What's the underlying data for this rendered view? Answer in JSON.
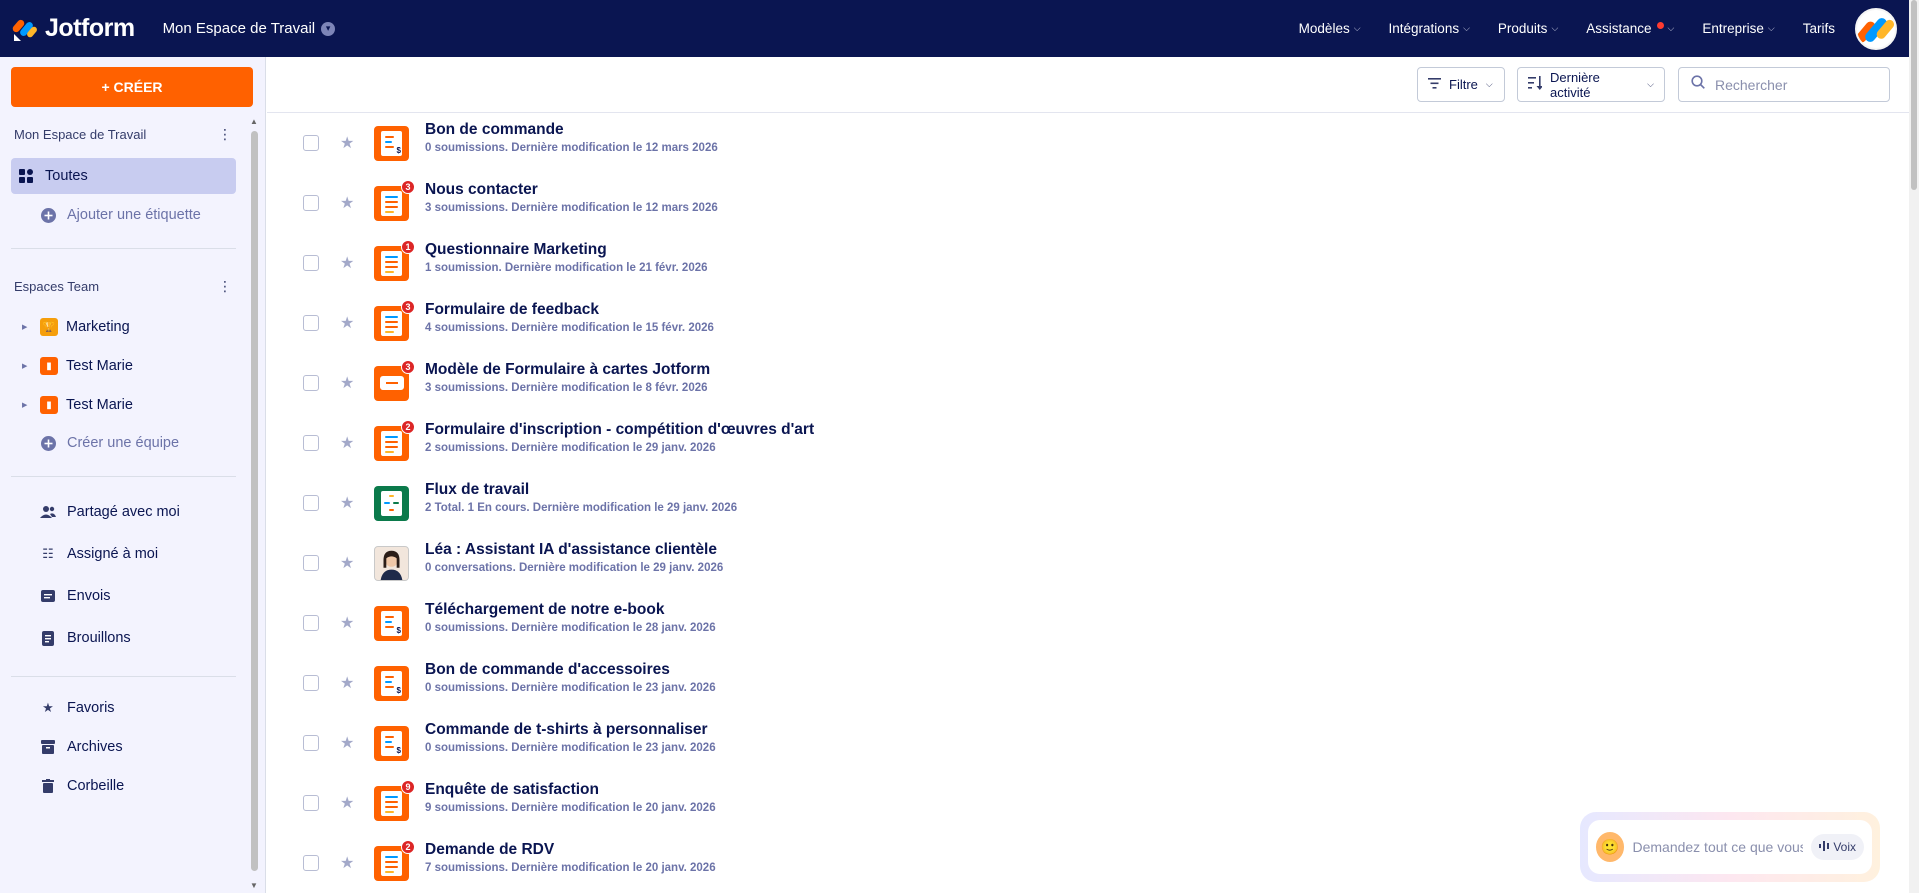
{
  "brand": {
    "name": "Jotform"
  },
  "workspace": {
    "name": "Mon Espace de Travail"
  },
  "nav": [
    {
      "label": "Modèles"
    },
    {
      "label": "Intégrations"
    },
    {
      "label": "Produits"
    },
    {
      "label": "Assistance"
    },
    {
      "label": "Entreprise"
    },
    {
      "label": "Tarifs"
    }
  ],
  "sidebar": {
    "create_label": "+ CRÉER",
    "my_workspace_title": "Mon Espace de Travail",
    "all_label": "Toutes",
    "add_tag_label": "Ajouter une étiquette",
    "team_spaces_title": "Espaces Team",
    "teams": [
      {
        "name": "Marketing",
        "color": "#f59e0b"
      },
      {
        "name": "Test Marie",
        "color": "#ff6100"
      },
      {
        "name": "Test Marie",
        "color": "#ff6100"
      }
    ],
    "create_team_label": "Créer une équipe",
    "shared_label": "Partagé avec moi",
    "assigned_label": "Assigné à moi",
    "sent_label": "Envois",
    "drafts_label": "Brouillons",
    "favorites_label": "Favoris",
    "archives_label": "Archives",
    "trash_label": "Corbeille"
  },
  "toolbar": {
    "filter_label": "Filtre",
    "sort_label": "Dernière activité",
    "search_placeholder": "Rechercher"
  },
  "forms": [
    {
      "title": "Bon de commande",
      "subtitle": "0 soumissions. Dernière modification le 12 mars 2026",
      "icon": "payment",
      "badge": ""
    },
    {
      "title": "Nous contacter",
      "subtitle": "3 soumissions. Dernière modification le 12 mars 2026",
      "icon": "form",
      "badge": "3"
    },
    {
      "title": "Questionnaire Marketing",
      "subtitle": "1 soumission. Dernière modification le 21 févr. 2026",
      "icon": "form",
      "badge": "1"
    },
    {
      "title": "Formulaire de feedback",
      "subtitle": "4 soumissions. Dernière modification le 15 févr. 2026",
      "icon": "form",
      "badge": "3"
    },
    {
      "title": "Modèle de Formulaire à cartes Jotform",
      "subtitle": "3 soumissions. Dernière modification le 8 févr. 2026",
      "icon": "card",
      "badge": "3"
    },
    {
      "title": "Formulaire d'inscription - compétition d'œuvres d'art",
      "subtitle": "2 soumissions. Dernière modification le 29 janv. 2026",
      "icon": "form",
      "badge": "2"
    },
    {
      "title": "Flux de travail",
      "subtitle": "2 Total. 1 En cours. Dernière modification le 29 janv. 2026",
      "icon": "workflow",
      "badge": ""
    },
    {
      "title": "Léa : Assistant IA d'assistance clientèle",
      "subtitle": "0 conversations. Dernière modification le 29 janv. 2026",
      "icon": "agent",
      "badge": ""
    },
    {
      "title": "Téléchargement de notre e-book",
      "subtitle": "0 soumissions. Dernière modification le 28 janv. 2026",
      "icon": "payment",
      "badge": ""
    },
    {
      "title": "Bon de commande d'accessoires",
      "subtitle": "0 soumissions. Dernière modification le 23 janv. 2026",
      "icon": "payment",
      "badge": ""
    },
    {
      "title": "Commande de t-shirts à personnaliser",
      "subtitle": "0 soumissions. Dernière modification le 23 janv. 2026",
      "icon": "payment",
      "badge": ""
    },
    {
      "title": "Enquête de satisfaction",
      "subtitle": "9 soumissions. Dernière modification le 20 janv. 2026",
      "icon": "form",
      "badge": "9"
    },
    {
      "title": "Demande de RDV",
      "subtitle": "7 soumissions. Dernière modification le 20 janv. 2026",
      "icon": "form",
      "badge": "2"
    }
  ],
  "ai_chat": {
    "placeholder": "Demandez tout ce que vous",
    "voice_label": "Voix"
  }
}
